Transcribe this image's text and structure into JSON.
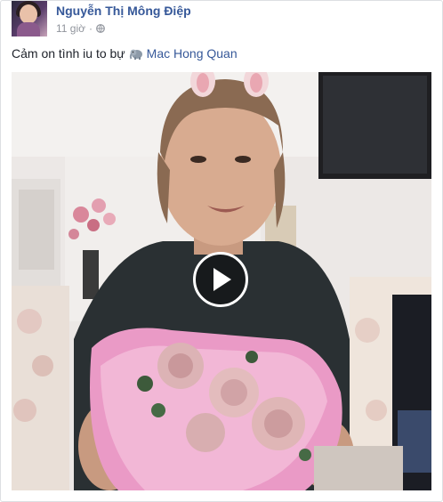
{
  "post": {
    "author": "Nguyễn Thị Mông Điệp",
    "time": "11 giờ",
    "separator": "·",
    "audience_icon": "globe-icon",
    "text": "Cảm on tình iu to bự",
    "emoji": "elephant-emoji",
    "tagged_user": "Mac Hong Quan"
  },
  "video": {
    "play_icon": "play-icon"
  },
  "colors": {
    "link": "#365899",
    "meta": "#90949c",
    "text": "#1d2129"
  }
}
